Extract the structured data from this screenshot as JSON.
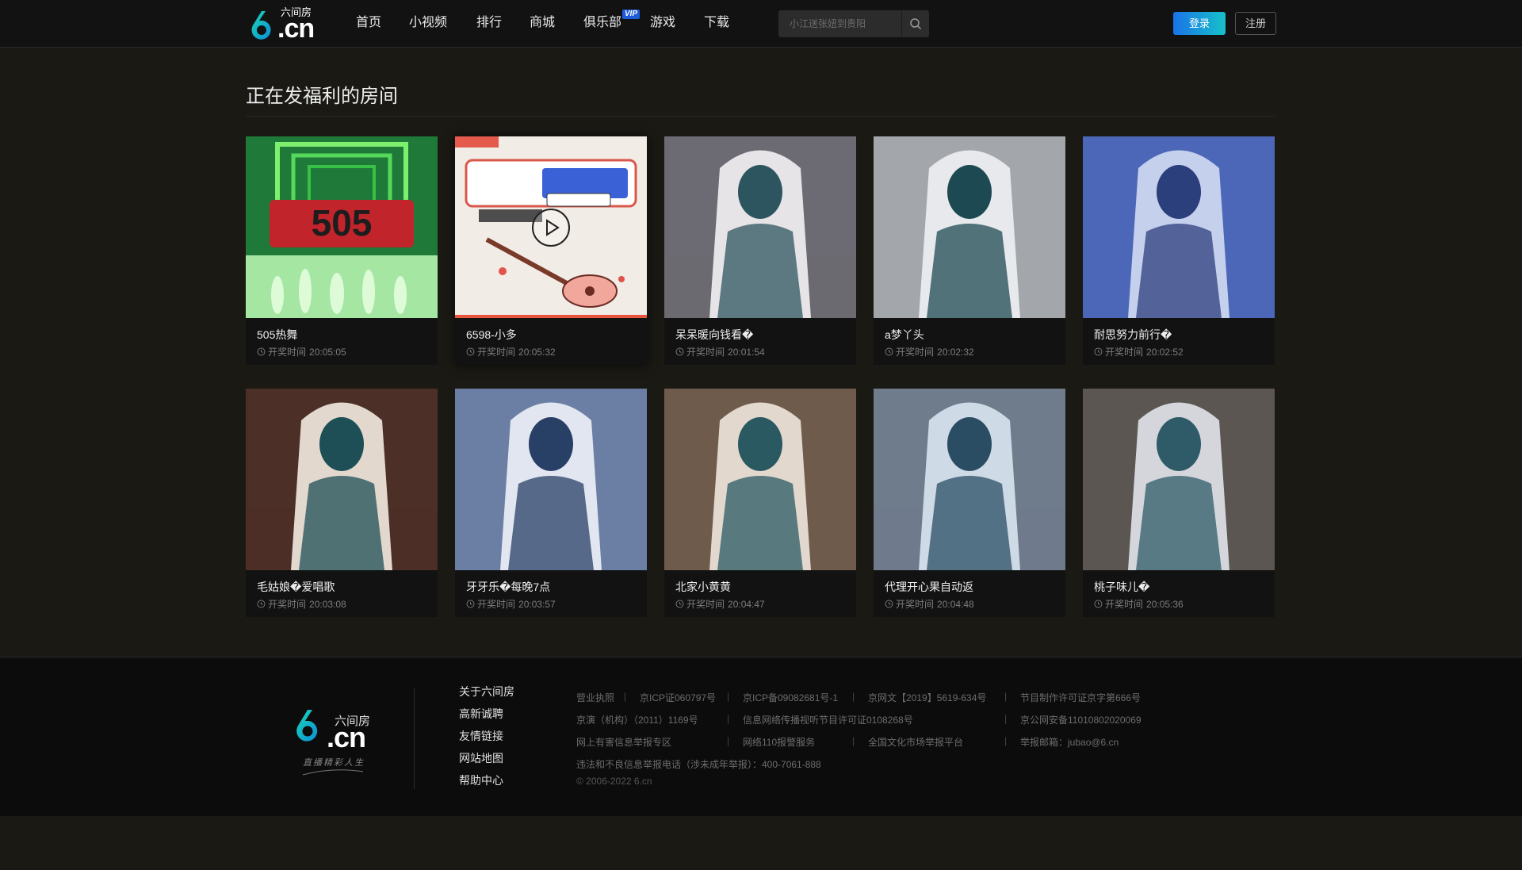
{
  "header": {
    "logo": {
      "brand_cn": ".cn",
      "brand_zh": "六间房"
    },
    "nav": [
      {
        "label": "首页",
        "badge": ""
      },
      {
        "label": "小视频",
        "badge": ""
      },
      {
        "label": "排行",
        "badge": ""
      },
      {
        "label": "商城",
        "badge": ""
      },
      {
        "label": "俱乐部",
        "badge": "VIP"
      },
      {
        "label": "游戏",
        "badge": ""
      },
      {
        "label": "下载",
        "badge": ""
      }
    ],
    "search": {
      "placeholder": "小江送张妞到贵阳",
      "icon": "search-icon"
    },
    "login_label": "登录",
    "register_label": "注册"
  },
  "main": {
    "title": "正在发福利的房间",
    "time_prefix": "开奖时间",
    "rooms": [
      {
        "name": "505热舞",
        "time": "20:05:05",
        "thumb": "dance-stage"
      },
      {
        "name": "6598-小多",
        "time": "20:05:32",
        "thumb": "guitar-poster",
        "active": true
      },
      {
        "name": "呆呆暖向钱看�",
        "time": "20:01:54",
        "thumb": "portrait"
      },
      {
        "name": "a梦丫头",
        "time": "20:02:32",
        "thumb": "portrait"
      },
      {
        "name": "耐思努力前行�",
        "time": "20:02:52",
        "thumb": "portrait"
      },
      {
        "name": "毛姑娘�爱唱歌",
        "time": "20:03:08",
        "thumb": "portrait"
      },
      {
        "name": "牙牙乐�每晚7点",
        "time": "20:03:57",
        "thumb": "portrait"
      },
      {
        "name": "北家小黄黄",
        "time": "20:04:47",
        "thumb": "portrait"
      },
      {
        "name": "代理开心果自动返",
        "time": "20:04:48",
        "thumb": "portrait"
      },
      {
        "name": "桃子味儿�",
        "time": "20:05:36",
        "thumb": "portrait"
      }
    ]
  },
  "footer": {
    "logo": {
      "brand_cn": ".cn",
      "brand_zh": "六间房",
      "slogan": "直播精彩人生"
    },
    "links": [
      "关于六间房",
      "高新诚聘",
      "友情链接",
      "网站地图",
      "帮助中心"
    ],
    "info_rows": [
      [
        "营业执照",
        "京ICP证060797号",
        "京ICP备09082681号-1",
        "京网文【2019】5619-634号",
        "节目制作许可证京字第666号"
      ],
      [
        "京演（机构）（2011）1169号",
        "信息网络传播视听节目许可证0108268号",
        "京公网安备11010802020069"
      ],
      [
        "网上有害信息举报专区",
        "网络110报警服务",
        "全国文化市场举报平台",
        "举报邮箱：jubao@6.cn"
      ],
      [
        "违法和不良信息举报电话（涉未成年举报）：400-7061-888"
      ]
    ],
    "copyright": "© 2006-2022 6.cn"
  },
  "colors": {
    "page_bg": "#1a1914",
    "header_bg": "#121212",
    "accent_blue": "#1a73e8",
    "accent_cyan": "#17c1c9",
    "vip_badge": "#1f5bd8",
    "active_bar": "#e8553c"
  }
}
